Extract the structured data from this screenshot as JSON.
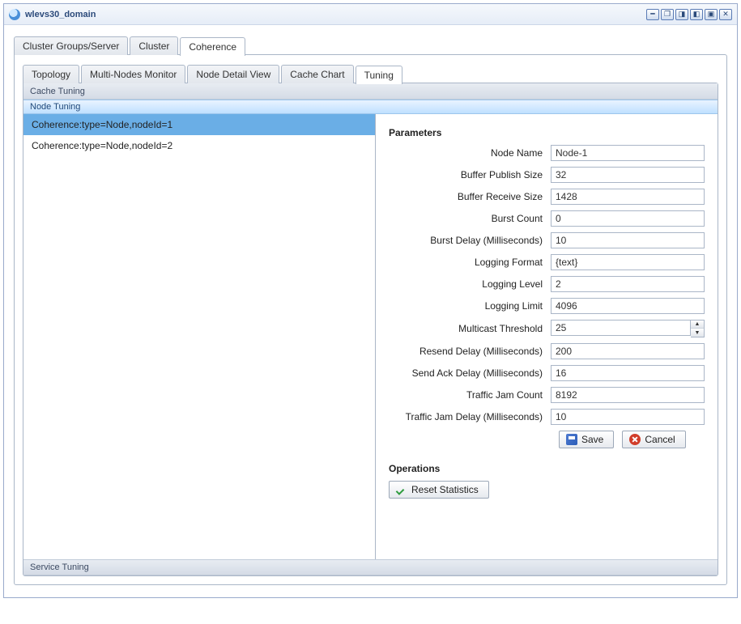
{
  "window": {
    "title": "wlevs30_domain"
  },
  "outerTabs": {
    "items": [
      "Cluster Groups/Server",
      "Cluster",
      "Coherence"
    ],
    "activeIndex": 2
  },
  "innerTabs": {
    "items": [
      "Topology",
      "Multi-Nodes Monitor",
      "Node Detail View",
      "Cache Chart",
      "Tuning"
    ],
    "activeIndex": 4
  },
  "accordion": {
    "cache": "Cache Tuning",
    "node": "Node Tuning",
    "service": "Service Tuning"
  },
  "nodes": {
    "items": [
      "Coherence:type=Node,nodeId=1",
      "Coherence:type=Node,nodeId=2"
    ],
    "selectedIndex": 0
  },
  "params": {
    "title": "Parameters",
    "fields": {
      "nodeName": {
        "label": "Node Name",
        "value": "Node-1"
      },
      "bufferPublishSize": {
        "label": "Buffer Publish Size",
        "value": "32"
      },
      "bufferReceiveSize": {
        "label": "Buffer Receive Size",
        "value": "1428"
      },
      "burstCount": {
        "label": "Burst Count",
        "value": "0"
      },
      "burstDelay": {
        "label": "Burst Delay (Milliseconds)",
        "value": "10"
      },
      "loggingFormat": {
        "label": "Logging Format",
        "value": "{text}"
      },
      "loggingLevel": {
        "label": "Logging Level",
        "value": "2"
      },
      "loggingLimit": {
        "label": "Logging Limit",
        "value": "4096"
      },
      "multicastThreshold": {
        "label": "Multicast Threshold",
        "value": "25"
      },
      "resendDelay": {
        "label": "Resend Delay (Milliseconds)",
        "value": "200"
      },
      "sendAckDelay": {
        "label": "Send Ack Delay (Milliseconds)",
        "value": "16"
      },
      "trafficJamCount": {
        "label": "Traffic Jam Count",
        "value": "8192"
      },
      "trafficJamDelay": {
        "label": "Traffic Jam Delay (Milliseconds)",
        "value": "10"
      }
    },
    "saveLabel": "Save",
    "cancelLabel": "Cancel"
  },
  "operations": {
    "title": "Operations",
    "resetLabel": "Reset Statistics"
  }
}
